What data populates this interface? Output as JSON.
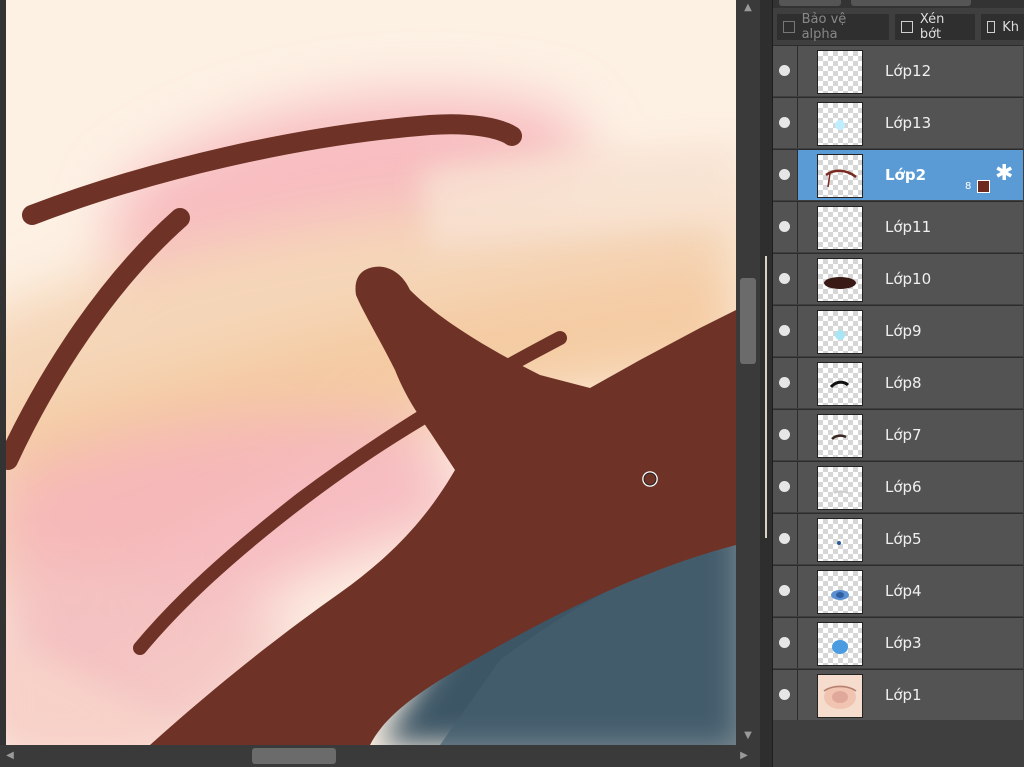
{
  "options": [
    {
      "label": "Bảo vệ alpha",
      "checked": false,
      "enabled": false
    },
    {
      "label": "Xén bớt",
      "checked": false,
      "enabled": true
    },
    {
      "label": "Kh",
      "checked": false,
      "enabled": true
    }
  ],
  "layers": [
    {
      "name": "Lớp12",
      "visible": true,
      "selected": false,
      "thumb": "empty"
    },
    {
      "name": "Lớp13",
      "visible": true,
      "selected": false,
      "thumb": "light-blue-dot"
    },
    {
      "name": "Lớp2",
      "visible": true,
      "selected": true,
      "thumb": "brown-stroke",
      "opacity_badge": "8",
      "color": "#6e2a1e"
    },
    {
      "name": "Lớp11",
      "visible": true,
      "selected": false,
      "thumb": "empty"
    },
    {
      "name": "Lớp10",
      "visible": true,
      "selected": false,
      "thumb": "dark-blob"
    },
    {
      "name": "Lớp9",
      "visible": true,
      "selected": false,
      "thumb": "light-blue-dot"
    },
    {
      "name": "Lớp8",
      "visible": true,
      "selected": false,
      "thumb": "black-stroke"
    },
    {
      "name": "Lớp7",
      "visible": true,
      "selected": false,
      "thumb": "dark-stroke"
    },
    {
      "name": "Lớp6",
      "visible": true,
      "selected": false,
      "thumb": "faint"
    },
    {
      "name": "Lớp5",
      "visible": true,
      "selected": false,
      "thumb": "blue-dot"
    },
    {
      "name": "Lớp4",
      "visible": true,
      "selected": false,
      "thumb": "blue-eye"
    },
    {
      "name": "Lớp3",
      "visible": true,
      "selected": false,
      "thumb": "blue-iris"
    },
    {
      "name": "Lớp1",
      "visible": true,
      "selected": false,
      "thumb": "eye-sketch"
    }
  ],
  "colors": {
    "selected_layer": "#5b9bd5",
    "panel_bg": "#3f3f3f",
    "brush_color": "#6e2a1e"
  },
  "icons": {
    "visibility": "eye-icon",
    "settings": "gear-icon",
    "scroll_up": "arrow-up-icon",
    "scroll_down": "arrow-down-icon",
    "scroll_left": "arrow-left-icon",
    "scroll_right": "arrow-right-icon",
    "cursor": "brush-cursor-icon"
  }
}
